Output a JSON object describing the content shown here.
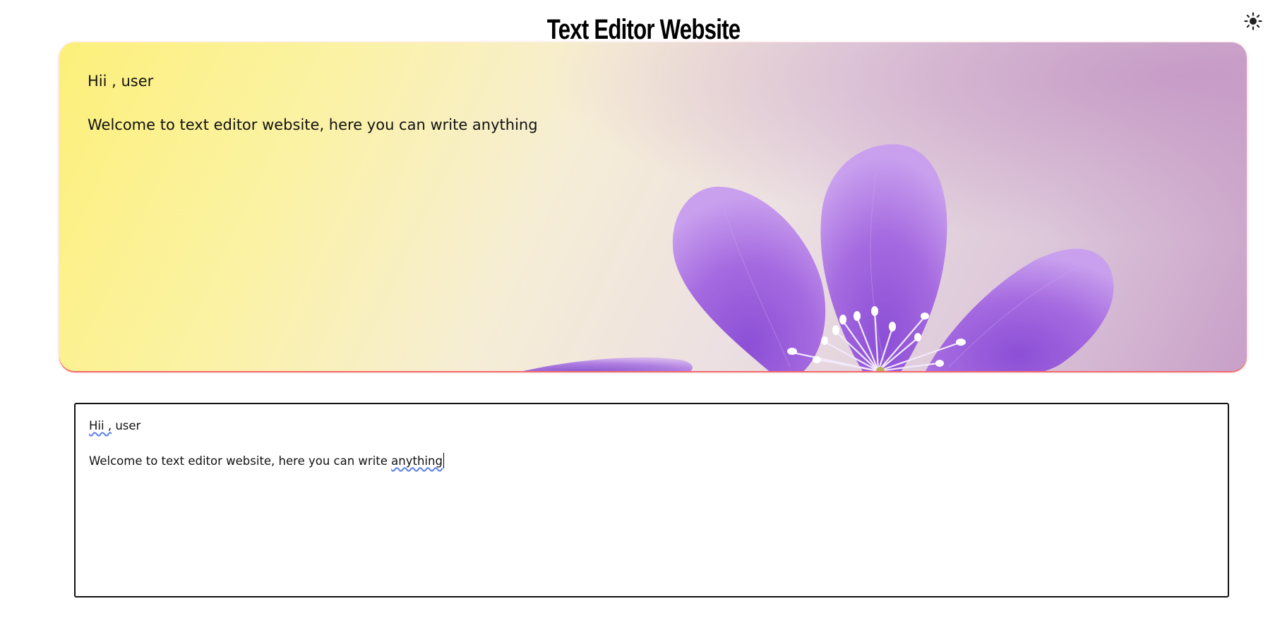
{
  "header": {
    "title": "Text Editor Website",
    "theme_toggle_icon": "sun-icon"
  },
  "preview": {
    "greeting": "Hii , user",
    "message": "Welcome to text editor website, here you can write anything",
    "background_image": "purple-flower-on-yellow-gradient"
  },
  "editor": {
    "line1_misspelled": "Hii ,",
    "line1_rest": " user",
    "line2_start": "Welcome to text editor website, here you can write ",
    "line2_misspelled": "anything"
  },
  "colors": {
    "preview_gradient_start": "#fcf07a",
    "preview_gradient_end": "#c89fc8",
    "flower_petal": "#a56ae0",
    "preview_border": "#f26b6b",
    "spellcheck_underline": "#5a82e6"
  }
}
